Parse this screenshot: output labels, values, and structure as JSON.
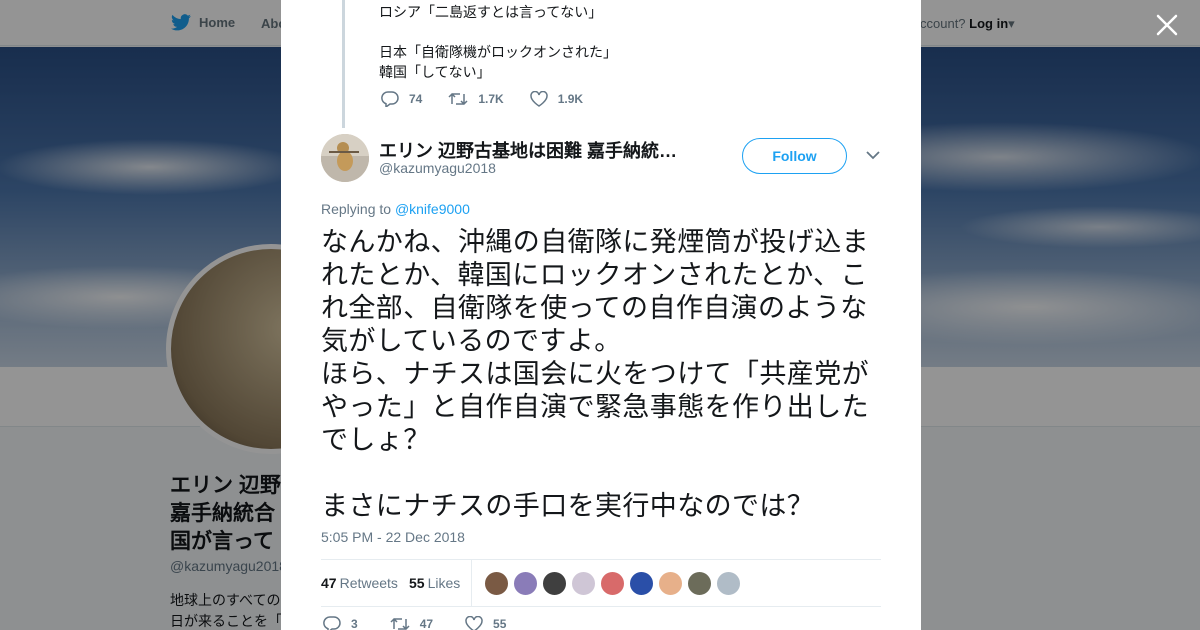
{
  "background": {
    "nav": {
      "home": "Home",
      "about": "Abo",
      "account_prefix": "ccount?",
      "login": "Log in"
    },
    "profile": {
      "name": "エリン 辺野 嘉手納統合 国が言って",
      "handle": "@kazumyagu2018",
      "bio": "地球上のすべての 日が来ることを「"
    }
  },
  "parent_tweet": {
    "text": "ロシア「二島返すとは言ってない」\n\n日本「自衛隊機がロックオンされた」\n韓国「してない」",
    "replies": "74",
    "retweets": "1.7K",
    "likes": "1.9K"
  },
  "tweet": {
    "author_name": "エリン 辺野古基地は困難 嘉手納統…",
    "author_handle": "@kazumyagu2018",
    "follow_label": "Follow",
    "replying_to_label": "Replying to",
    "replying_to_handle": "@knife9000",
    "text": "なんかね、沖縄の自衛隊に発煙筒が投げ込まれたとか、韓国にロックオンされたとか、これ全部、自衛隊を使っての自作自演のような気がしているのですよ。\nほら、ナチスは国会に火をつけて「共産党がやった」と自作自演で緊急事態を作り出したでしょ？\n\nまさにナチスの手口を実行中なのでは？",
    "timestamp": "5:05 PM - 22 Dec 2018",
    "retweets_count": "47",
    "retweets_label": "Retweets",
    "likes_count": "55",
    "likes_label": "Likes",
    "reply_count": "3",
    "retweet_count_bottom": "47",
    "like_count_bottom": "55"
  },
  "likers": [
    {
      "color": "#7a5a44"
    },
    {
      "color": "#8a7cb8"
    },
    {
      "color": "#3f3f3f"
    },
    {
      "color": "#cfc6d6"
    },
    {
      "color": "#d86a6a"
    },
    {
      "color": "#2a4fa8"
    },
    {
      "color": "#e7b08a"
    },
    {
      "color": "#6c6c5a"
    },
    {
      "color": "#b0bcc7"
    }
  ],
  "colors": {
    "accent": "#1da1f2",
    "text": "#14171a",
    "muted": "#657786"
  }
}
